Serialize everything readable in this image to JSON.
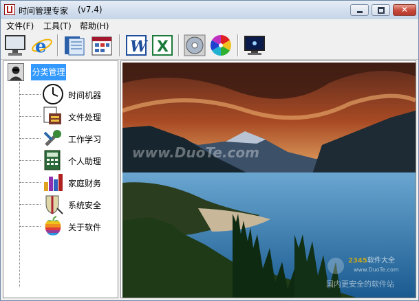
{
  "window": {
    "title": "时间管理专家",
    "version": "(v7.4)",
    "close_glyph": "✕"
  },
  "menu": [
    {
      "label": "文件(F)"
    },
    {
      "label": "工具(T)"
    },
    {
      "label": "帮助(H)"
    }
  ],
  "toolbar": [
    {
      "icon": "monitor-icon"
    },
    {
      "icon": "browser-icon"
    },
    {
      "icon": "notes-icon"
    },
    {
      "icon": "calendar-icon"
    },
    {
      "icon": "word-icon",
      "text": "W"
    },
    {
      "icon": "excel-icon",
      "text": "X"
    },
    {
      "icon": "disc-icon"
    },
    {
      "icon": "color-wheel-icon"
    },
    {
      "icon": "screen-icon"
    }
  ],
  "tree": {
    "root": {
      "label": "分类管理",
      "icon": "avatar-icon"
    },
    "items": [
      {
        "label": "时间机器",
        "icon": "clock-icon"
      },
      {
        "label": "文件处理",
        "icon": "file-tools-icon"
      },
      {
        "label": "工作学习",
        "icon": "wrench-icon"
      },
      {
        "label": "个人助理",
        "icon": "calculator-icon"
      },
      {
        "label": "家庭财务",
        "icon": "bar-chart-icon"
      },
      {
        "label": "系统安全",
        "icon": "shield-icon"
      },
      {
        "label": "关于软件",
        "icon": "apple-icon"
      }
    ]
  },
  "viewer": {
    "watermark": "www.DuoTe.com",
    "badge_number": "2345",
    "badge_text": "软件大全",
    "badge_url": "www.DuoTe.com",
    "footer_text": "国内更安全的软件站"
  },
  "colors": {
    "selection": "#3399ff",
    "close_button": "#c6493a"
  }
}
